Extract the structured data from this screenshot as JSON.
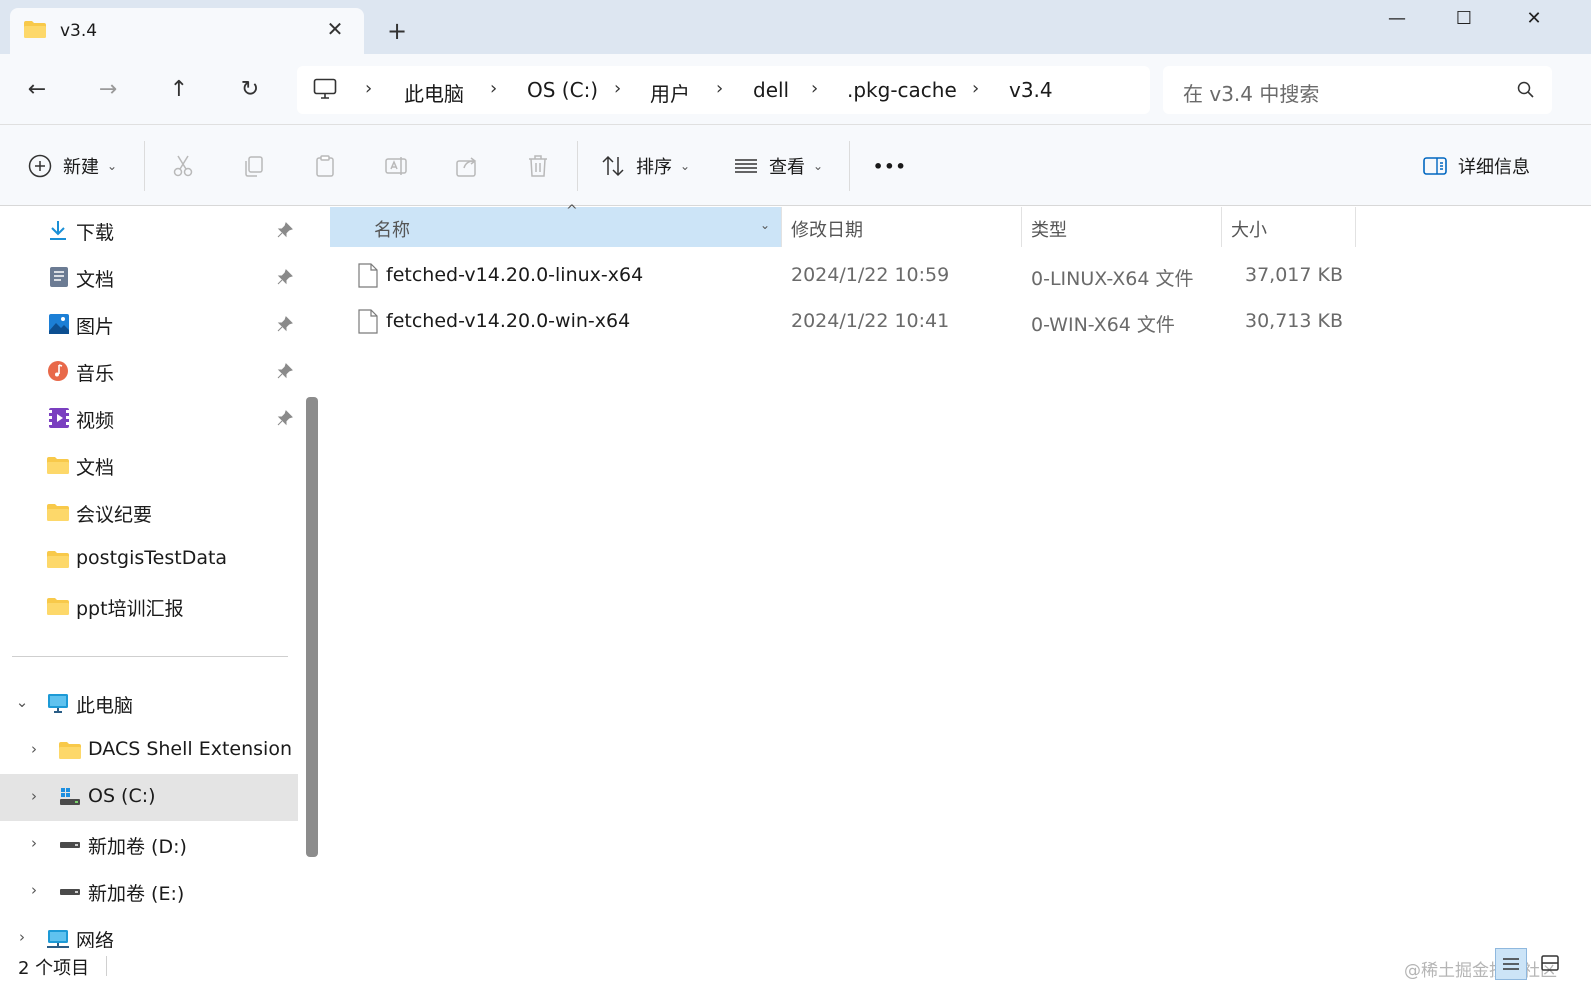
{
  "tab": {
    "title": "v3.4",
    "close_glyph": "✕",
    "new_tab_glyph": "+"
  },
  "window": {
    "minimize_glyph": "—",
    "maximize_glyph": "☐",
    "close_glyph": "✕"
  },
  "nav": {
    "back_glyph": "←",
    "forward_glyph": "→",
    "up_glyph": "↑",
    "refresh_glyph": "↻"
  },
  "breadcrumb": {
    "separator": "›",
    "items": [
      "此电脑",
      "OS (C:)",
      "用户",
      "dell",
      ".pkg-cache",
      "v3.4"
    ]
  },
  "search": {
    "placeholder": "在 v3.4 中搜索"
  },
  "toolbar": {
    "new_label": "新建",
    "sort_label": "排序",
    "view_label": "查看",
    "more_label": "•••",
    "details_label": "详细信息",
    "chevron_glyph": "⌄"
  },
  "sidebar": {
    "quick_access": [
      {
        "label": "下载",
        "icon": "download-icon",
        "pinned": true
      },
      {
        "label": "文档",
        "icon": "documents-icon",
        "pinned": true
      },
      {
        "label": "图片",
        "icon": "pictures-icon",
        "pinned": true
      },
      {
        "label": "音乐",
        "icon": "music-icon",
        "pinned": true
      },
      {
        "label": "视频",
        "icon": "videos-icon",
        "pinned": true
      },
      {
        "label": "文档",
        "icon": "folder-icon",
        "pinned": false
      },
      {
        "label": "会议纪要",
        "icon": "folder-icon",
        "pinned": false
      },
      {
        "label": "postgisTestData",
        "icon": "folder-icon",
        "pinned": false
      },
      {
        "label": "ppt培训汇报",
        "icon": "folder-icon",
        "pinned": false
      }
    ],
    "this_pc": {
      "label": "此电脑",
      "expand_glyph": "⌄"
    },
    "drives": [
      {
        "label": "DACS Shell Extension",
        "icon": "folder-icon",
        "selected": false
      },
      {
        "label": "OS (C:)",
        "icon": "windows-drive-icon",
        "selected": true
      },
      {
        "label": "新加卷 (D:)",
        "icon": "drive-icon",
        "selected": false
      },
      {
        "label": "新加卷 (E:)",
        "icon": "drive-icon",
        "selected": false
      }
    ],
    "network": {
      "label": "网络"
    },
    "collapse_glyph": "›"
  },
  "columns": {
    "name": "名称",
    "date": "修改日期",
    "type": "类型",
    "size": "大小",
    "sort_glyph": "^",
    "drop_glyph": "⌄"
  },
  "files": [
    {
      "name": "fetched-v14.20.0-linux-x64",
      "date": "2024/1/22 10:59",
      "type": "0-LINUX-X64 文件",
      "size": "37,017 KB"
    },
    {
      "name": "fetched-v14.20.0-win-x64",
      "date": "2024/1/22 10:41",
      "type": "0-WIN-X64 文件",
      "size": "30,713 KB"
    }
  ],
  "status": {
    "item_count": "2 个项目",
    "watermark": "@稀土掘金技术社区"
  },
  "colors": {
    "accent": "#0067c0",
    "selection": "#cce4f7",
    "folder": "#f8c94a",
    "chrome": "#dde6f1"
  }
}
